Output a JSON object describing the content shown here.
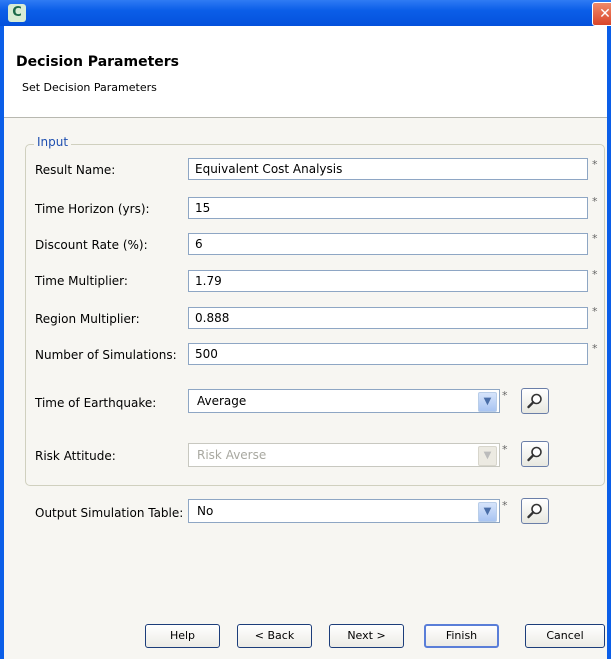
{
  "window": {
    "icon_glyph": "C",
    "close_glyph": "✕"
  },
  "header": {
    "title": "Decision Parameters",
    "subtitle": "Set Decision Parameters"
  },
  "group": {
    "label": "Input"
  },
  "required_marker": "*",
  "fields": [
    {
      "label": "Result Name:",
      "value": "Equivalent Cost Analysis"
    },
    {
      "label": "Time Horizon (yrs):",
      "value": "15"
    },
    {
      "label": "Discount Rate (%):",
      "value": "6"
    },
    {
      "label": "Time Multiplier:",
      "value": "1.79"
    },
    {
      "label": "Region Multiplier:",
      "value": "0.888"
    },
    {
      "label": "Number of Simulations:",
      "value": "500"
    }
  ],
  "selects": [
    {
      "label": "Time of Earthquake:",
      "value": "Average",
      "disabled": false
    },
    {
      "label": "Risk Attitude:",
      "value": "Risk Averse",
      "disabled": true
    },
    {
      "label": "Output Simulation Table:",
      "value": "No",
      "disabled": false
    }
  ],
  "buttons": {
    "help": "Help",
    "back": "< Back",
    "next": "Next >",
    "finish": "Finish",
    "cancel": "Cancel"
  },
  "icons": {
    "dropdown": "chevron-down-icon",
    "lookup": "magnifier-icon"
  }
}
